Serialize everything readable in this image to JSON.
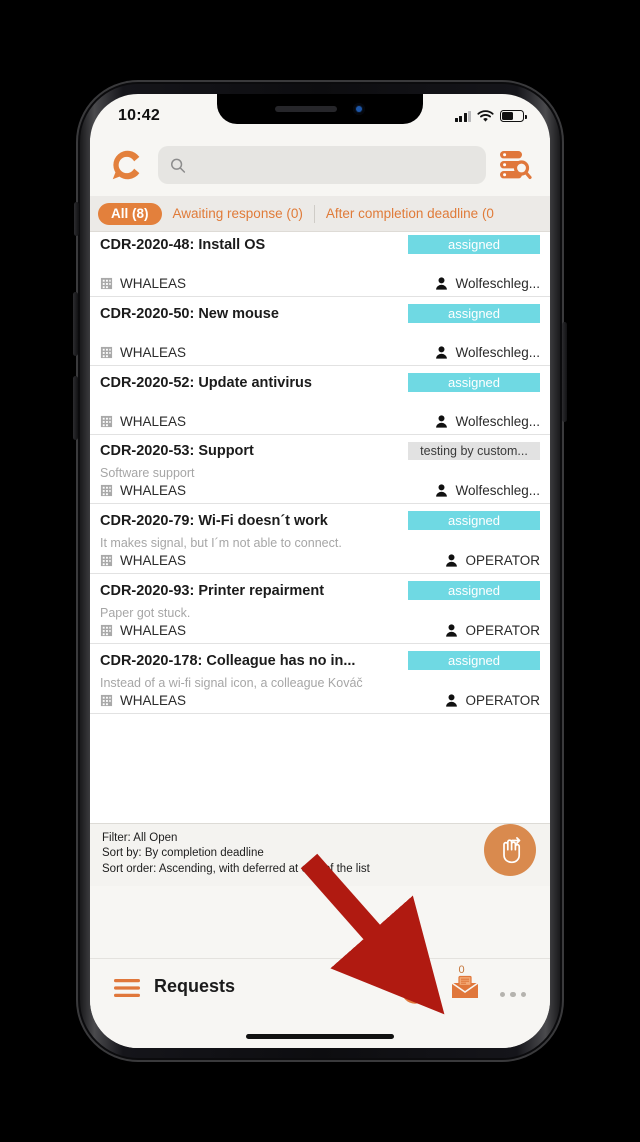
{
  "status_bar": {
    "time": "10:42",
    "signal_icon": "cellular-signal-icon",
    "wifi_icon": "wifi-icon",
    "battery_icon": "battery-icon"
  },
  "header": {
    "logo_icon": "app-logo-c-icon",
    "search_placeholder": "",
    "search_value": "",
    "search_icon": "search-icon",
    "advanced_search_icon": "advanced-search-list-icon"
  },
  "filter_tabs": [
    {
      "label": "All (8)",
      "active": true
    },
    {
      "label": "Awaiting response (0)",
      "active": false
    },
    {
      "label": "After completion deadline (0",
      "active": false
    }
  ],
  "requests": [
    {
      "title": "CDR-2020-48: Install OS",
      "status": "assigned",
      "status_kind": "assigned",
      "description": "",
      "company": "WHALEAS",
      "assignee": "Wolfeschleg..."
    },
    {
      "title": "CDR-2020-50: New mouse",
      "status": "assigned",
      "status_kind": "assigned",
      "description": "",
      "company": "WHALEAS",
      "assignee": "Wolfeschleg..."
    },
    {
      "title": "CDR-2020-52: Update antivirus",
      "status": "assigned",
      "status_kind": "assigned",
      "description": "",
      "company": "WHALEAS",
      "assignee": "Wolfeschleg..."
    },
    {
      "title": "CDR-2020-53: Support",
      "status": "testing by custom...",
      "status_kind": "muted",
      "description": "Software support",
      "company": "WHALEAS",
      "assignee": "Wolfeschleg..."
    },
    {
      "title": "CDR-2020-79: Wi-Fi doesn´t work",
      "status": "assigned",
      "status_kind": "assigned",
      "description": "It makes signal, but I´m not able to connect.",
      "company": "WHALEAS",
      "assignee": "OPERATOR"
    },
    {
      "title": "CDR-2020-93: Printer repairment",
      "status": "assigned",
      "status_kind": "assigned",
      "description": "Paper got stuck.",
      "company": "WHALEAS",
      "assignee": "OPERATOR"
    },
    {
      "title": "CDR-2020-178: Colleague has no in...",
      "status": "assigned",
      "status_kind": "assigned",
      "description": "Instead of a wi-fi signal icon, a colleague Kováč",
      "company": "WHALEAS",
      "assignee": "OPERATOR"
    }
  ],
  "filter_info": {
    "line1": "Filter: All Open",
    "line2": "Sort by: By completion deadline",
    "line3": "Sort order: Ascending, with deferred at end of the list"
  },
  "fab": {
    "icon": "swipe-gesture-hand-icon"
  },
  "bottom_bar": {
    "menu_icon": "hamburger-menu-icon",
    "title": "Requests",
    "add_icon": "plus-circle-icon",
    "mail_icon": "envelope-icon",
    "mail_badge": "0",
    "more_icon": "more-options-icon"
  },
  "colors": {
    "brand_orange": "#e3803c",
    "status_cyan": "#6fd9e3",
    "status_muted": "#e2e2e2",
    "arrow_red": "#b01a11"
  }
}
